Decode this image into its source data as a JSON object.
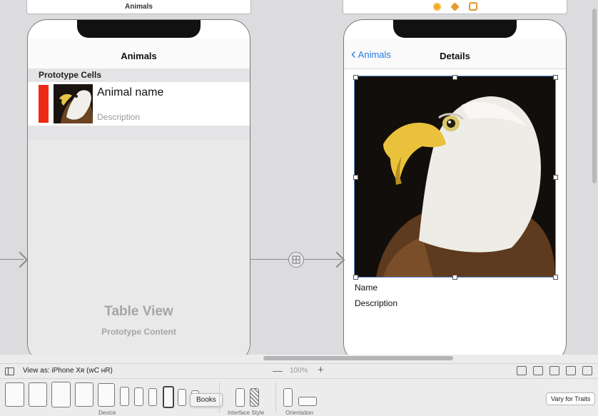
{
  "storyboard": {
    "left_scene_bar_title": "Animals",
    "left_scene": {
      "nav_title": "Animals",
      "section_header": "Prototype Cells",
      "cell": {
        "title": "Animal name",
        "subtitle": "Description"
      },
      "table_view_title": "Table View",
      "table_view_subtitle": "Prototype Content"
    },
    "right_scene": {
      "back_label": "Animals",
      "nav_title": "Details",
      "name_label": "Name",
      "description_label": "Description"
    }
  },
  "bottom_bar": {
    "view_as_label": "View as: iPhone Xʀ (ᴡC ʜR)",
    "zoom_minus": "—",
    "zoom_level": "100%",
    "zoom_plus": "+",
    "device_group_label": "Device",
    "interface_style_label": "Interface Style",
    "orientation_label": "Orientation",
    "tooltip": "Books",
    "vary_button": "Vary for Traits"
  },
  "colors": {
    "accent": "#2a7ae2",
    "cell_color_bar": "#ef2a12"
  }
}
